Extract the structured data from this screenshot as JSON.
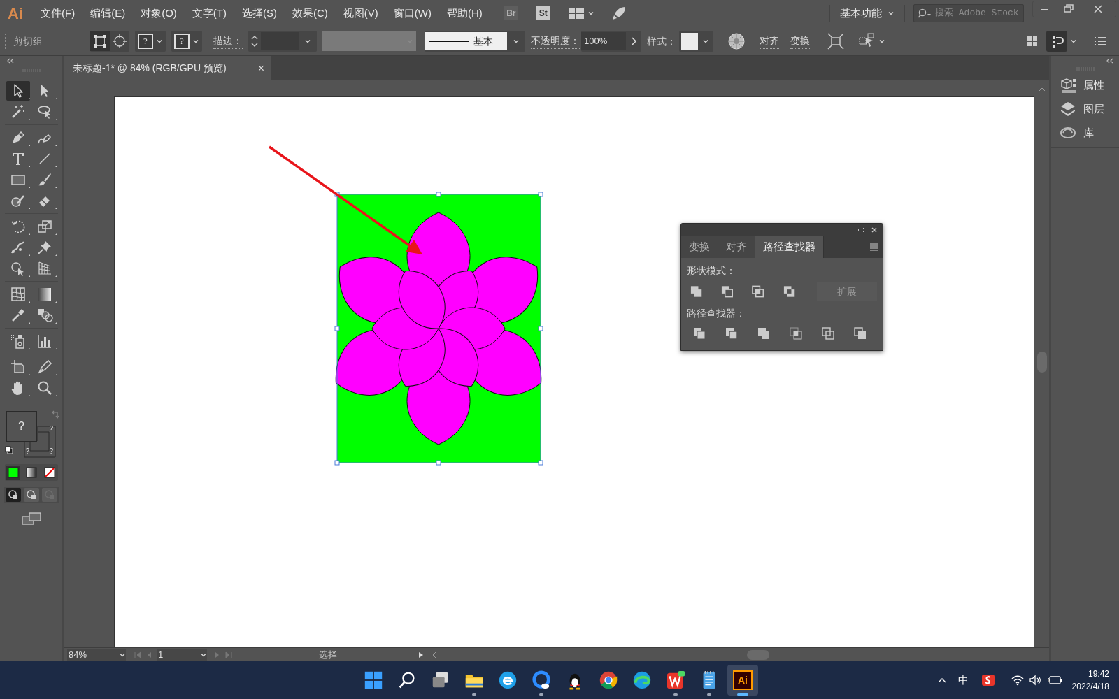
{
  "app": {
    "logo": "Ai",
    "menus": [
      "文件(F)",
      "编辑(E)",
      "对象(O)",
      "文字(T)",
      "选择(S)",
      "效果(C)",
      "视图(V)",
      "窗口(W)",
      "帮助(H)"
    ],
    "launchers": [
      "Br",
      "St"
    ],
    "workspace": "基本功能",
    "search_placeholder": "搜索 Adobe Stock"
  },
  "control_bar": {
    "selection_label": "剪切组",
    "fill_swatch_label": "?",
    "stroke_swatch_label": "?",
    "stroke_label": "描边：",
    "stroke_style": "基本",
    "opacity_label": "不透明度：",
    "opacity": "100%",
    "style_label": "样式：",
    "align": "对齐",
    "transform": "变换"
  },
  "document_tab": {
    "title": "未标题-1* @ 84% (RGB/GPU 预览)",
    "close": "×"
  },
  "tool_groups": [
    {
      "tools": [
        {
          "kind": "selection",
          "selected": true
        },
        {
          "kind": "direct-selection",
          "selected": false
        },
        {
          "kind": "magic-wand",
          "selected": false
        },
        {
          "kind": "lasso",
          "selected": false
        }
      ]
    },
    {
      "tools": [
        {
          "kind": "pen",
          "selected": false
        },
        {
          "kind": "curvature",
          "selected": false
        },
        {
          "kind": "type",
          "selected": false
        },
        {
          "kind": "line",
          "selected": false
        },
        {
          "kind": "rectangle",
          "selected": false
        },
        {
          "kind": "paintbrush",
          "selected": false
        },
        {
          "kind": "shaper",
          "selected": false
        },
        {
          "kind": "eraser",
          "selected": false
        }
      ]
    },
    {
      "tools": [
        {
          "kind": "rotate",
          "selected": false
        },
        {
          "kind": "scale",
          "selected": false
        },
        {
          "kind": "warp",
          "selected": false
        },
        {
          "kind": "pin",
          "selected": false
        },
        {
          "kind": "free-transform",
          "selected": false
        },
        {
          "kind": "perspective",
          "selected": false
        }
      ]
    },
    {
      "tools": [
        {
          "kind": "mesh",
          "selected": false
        },
        {
          "kind": "gradient",
          "selected": false
        },
        {
          "kind": "eyedropper",
          "selected": false
        },
        {
          "kind": "blend",
          "selected": false
        }
      ]
    },
    {
      "tools": [
        {
          "kind": "symbol-sprayer",
          "selected": false
        },
        {
          "kind": "graph",
          "selected": false
        }
      ]
    },
    {
      "tools": [
        {
          "kind": "artboard",
          "selected": false
        },
        {
          "kind": "slice",
          "selected": false
        },
        {
          "kind": "hand",
          "selected": false
        },
        {
          "kind": "zoom",
          "selected": false
        }
      ]
    }
  ],
  "fill_stroke": {
    "fill_label": "?",
    "stroke_labels": [
      "?",
      "?",
      "?"
    ]
  },
  "color_modes": [
    {
      "kind": "color",
      "selected": true
    },
    {
      "kind": "gradient",
      "selected": false
    },
    {
      "kind": "none",
      "selected": false
    }
  ],
  "draw_modes": [
    {
      "selected": true,
      "disabled": false
    },
    {
      "selected": false,
      "disabled": false
    },
    {
      "selected": false,
      "disabled": true
    }
  ],
  "right_panel": [
    {
      "kind": "properties",
      "label": "属性"
    },
    {
      "kind": "layers",
      "label": "图层"
    },
    {
      "kind": "libraries",
      "label": "库"
    }
  ],
  "pathfinder_panel": {
    "tabs": [
      {
        "label": "变换",
        "selected": false
      },
      {
        "label": "对齐",
        "selected": false
      },
      {
        "label": "路径查找器",
        "selected": true
      }
    ],
    "shape_modes_label": "形状模式：",
    "expand": {
      "label": "扩展",
      "disabled": true
    },
    "pathfinders_label": "路径查找器："
  },
  "status_bar": {
    "zoom": "84%",
    "artboard": "1",
    "tool": "选择"
  },
  "taskbar": {
    "apps": [
      {
        "kind": "start",
        "running": false,
        "selected": false
      },
      {
        "kind": "search",
        "running": false,
        "selected": false
      },
      {
        "kind": "task-view",
        "running": false,
        "selected": false
      },
      {
        "kind": "folder",
        "running": true,
        "selected": false
      },
      {
        "kind": "e-browser",
        "running": false,
        "selected": false
      },
      {
        "kind": "q-browser",
        "running": true,
        "selected": false
      },
      {
        "kind": "penguin",
        "running": false,
        "selected": false
      },
      {
        "kind": "chrome",
        "running": false,
        "selected": false
      },
      {
        "kind": "edge",
        "running": false,
        "selected": false
      },
      {
        "kind": "office",
        "running": true,
        "selected": false
      },
      {
        "kind": "notepad",
        "running": true,
        "selected": false
      },
      {
        "kind": "illustrator",
        "label": "Ai",
        "running": true,
        "selected": true
      }
    ],
    "ime": "中",
    "time": "19:42",
    "date": "2022/4/18"
  }
}
